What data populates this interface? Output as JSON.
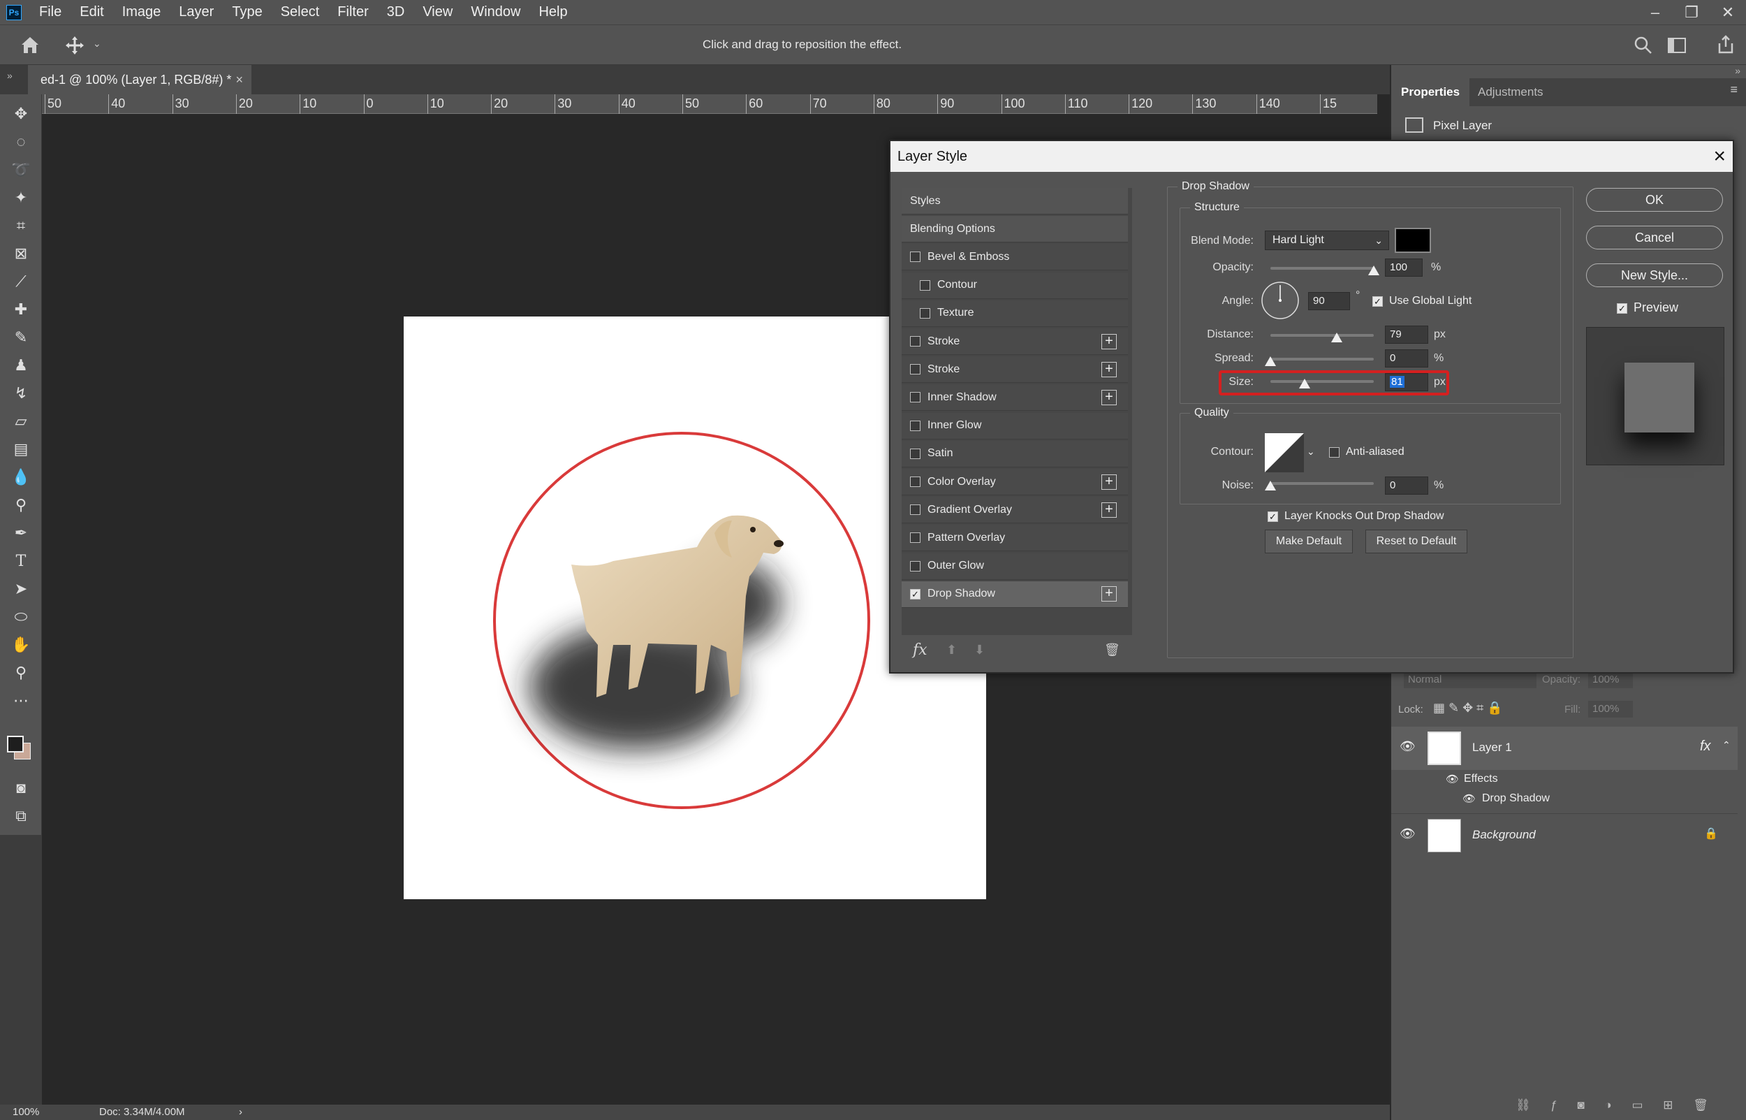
{
  "app": {
    "logo": "Ps"
  },
  "menu": [
    "File",
    "Edit",
    "Image",
    "Layer",
    "Type",
    "Select",
    "Filter",
    "3D",
    "View",
    "Window",
    "Help"
  ],
  "options_bar": {
    "hint": "Click and drag to reposition the effect."
  },
  "document_tab": {
    "title": "ed-1 @ 100% (Layer 1, RGB/8#) *",
    "close": "×"
  },
  "ruler_labels": [
    "50",
    "40",
    "30",
    "20",
    "10",
    "0",
    "10",
    "20",
    "30",
    "40",
    "50",
    "60",
    "70",
    "80",
    "90",
    "100",
    "110",
    "120",
    "130",
    "140",
    "15"
  ],
  "status": {
    "zoom": "100%",
    "doc": "Doc: 3.34M/4.00M"
  },
  "properties_panel": {
    "tabs": [
      "Properties",
      "Adjustments"
    ],
    "pixel_layer": "Pixel Layer"
  },
  "layers_panel": {
    "blend": "Normal",
    "opacity_label": "Opacity:",
    "opacity": "100%",
    "lock_label": "Lock:",
    "fill_label": "Fill:",
    "fill": "100%",
    "layers": [
      {
        "name": "Layer 1",
        "fx": "fx"
      },
      {
        "name": "Background"
      }
    ],
    "effects_label": "Effects",
    "drop_shadow_label": "Drop Shadow"
  },
  "dialog": {
    "title": "Layer Style",
    "styles_list": [
      {
        "label": "Styles",
        "type": "head"
      },
      {
        "label": "Blending Options",
        "type": "head"
      },
      {
        "label": "Bevel & Emboss",
        "checked": false
      },
      {
        "label": "Contour",
        "checked": false,
        "indent": true
      },
      {
        "label": "Texture",
        "checked": false,
        "indent": true
      },
      {
        "label": "Stroke",
        "checked": false,
        "plus": true
      },
      {
        "label": "Stroke",
        "checked": false,
        "plus": true
      },
      {
        "label": "Inner Shadow",
        "checked": false,
        "plus": true
      },
      {
        "label": "Inner Glow",
        "checked": false
      },
      {
        "label": "Satin",
        "checked": false
      },
      {
        "label": "Color Overlay",
        "checked": false,
        "plus": true
      },
      {
        "label": "Gradient Overlay",
        "checked": false,
        "plus": true
      },
      {
        "label": "Pattern Overlay",
        "checked": false
      },
      {
        "label": "Outer Glow",
        "checked": false
      },
      {
        "label": "Drop Shadow",
        "checked": true,
        "plus": true,
        "selected": true
      }
    ],
    "fx_label": "fx",
    "section": "Drop Shadow",
    "structure": {
      "legend": "Structure",
      "blend_mode_label": "Blend Mode:",
      "blend_mode": "Hard Light",
      "shadow_color": "#000000",
      "opacity_label": "Opacity:",
      "opacity": "100",
      "opacity_unit": "%",
      "angle_label": "Angle:",
      "angle": "90",
      "angle_unit": "°",
      "use_global_light": "Use Global Light",
      "distance_label": "Distance:",
      "distance": "79",
      "distance_unit": "px",
      "spread_label": "Spread:",
      "spread": "0",
      "spread_unit": "%",
      "size_label": "Size:",
      "size": "81",
      "size_unit": "px"
    },
    "quality": {
      "legend": "Quality",
      "contour_label": "Contour:",
      "anti_aliased": "Anti-aliased",
      "noise_label": "Noise:",
      "noise": "0",
      "noise_unit": "%"
    },
    "knockout": "Layer Knocks Out Drop Shadow",
    "make_default": "Make Default",
    "reset_default": "Reset to Default",
    "buttons": {
      "ok": "OK",
      "cancel": "Cancel",
      "new_style": "New Style..."
    },
    "preview_label": "Preview"
  },
  "sliders": {
    "opacity": 1.0,
    "distance": 0.64,
    "spread": 0.0,
    "size": 0.33,
    "noise": 0.0
  }
}
